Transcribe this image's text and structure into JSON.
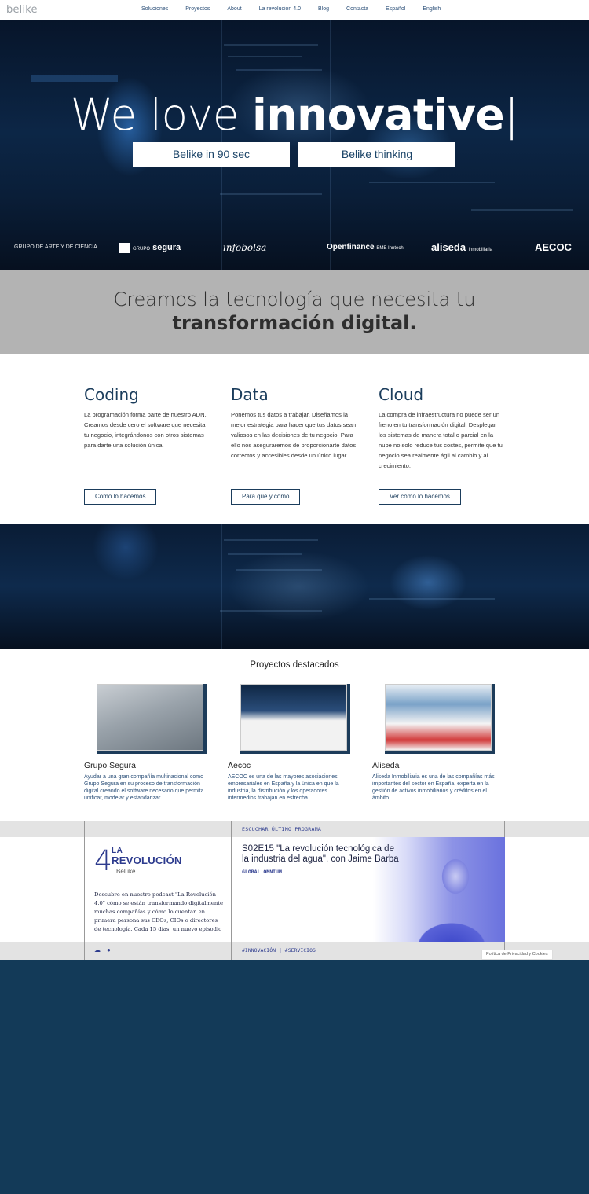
{
  "nav": {
    "logo": "belike",
    "items": [
      "Soluciones",
      "Proyectos",
      "About",
      "La revolución 4.0",
      "Blog",
      "Contacta",
      "Español",
      "English"
    ]
  },
  "hero": {
    "title_light": "We love ",
    "title_bold": "innovative",
    "cursor": "|",
    "btn1": "Belike in 90 sec",
    "btn2": "Belike thinking",
    "clients": [
      "GRUPO DE ARTE Y DE CIENCIA",
      "segura",
      "infobolsa",
      "Openfinance",
      "aliseda",
      "AECOC"
    ],
    "client_grupo_label": "GRUPO",
    "client_openfinance_sub": "BME Inntech",
    "client_aliseda_sub": "inmobiliaria"
  },
  "tagline": {
    "line1": "Creamos la tecnología que necesita tu",
    "line2": "transformación digital."
  },
  "services": [
    {
      "title": "Coding",
      "text": "La programación forma parte de nuestro ADN. Creamos desde cero el software que necesita tu negocio, integrándonos con otros sistemas para darte una solución única.",
      "button": "Cómo lo hacemos"
    },
    {
      "title": "Data",
      "text": "Ponemos tus datos a trabajar. Diseñamos la mejor estrategia para hacer que tus datos sean valiosos en las decisiones de tu negocio. Para ello nos aseguraremos de proporcionarte datos correctos y accesibles desde un único lugar.",
      "button": "Para qué y cómo"
    },
    {
      "title": "Cloud",
      "text": "La compra de infraestructura no puede ser un freno en tu transformación digital. Desplegar los sistemas de manera total o parcial en la nube no solo reduce tus costes, permite que tu negocio sea realmente ágil al cambio y al crecimiento.",
      "button": "Ver cómo lo hacemos"
    }
  ],
  "projects": {
    "title": "Proyectos destacados",
    "items": [
      {
        "name": "Grupo Segura",
        "text": "Ayudar a una gran compañía multinacional como Grupo Segura en su proceso de transformación digital creando el software necesario que permita unificar, modelar y estandarizar..."
      },
      {
        "name": "Aecoc",
        "text": "AECOC es una de las mayores asociaciones empresariales en España y la única en que la industria, la distribución y los operadores intermedios trabajan en estrecha..."
      },
      {
        "name": "Aliseda",
        "text": "Aliseda Inmobiliaria es una de las compañías más importantes del sector en España, experta en la gestión de activos inmobiliarios y créditos en el ámbito..."
      }
    ]
  },
  "podcast": {
    "listen_label": "ESCUCHAR ÚLTIMO PROGRAMA",
    "logo_four": "4",
    "logo_la": "LA",
    "logo_revolucion": "REVOLUCIÓN",
    "logo_by": "BeLike",
    "description": "Descubre en nuestro podcast \"La Revolución 4.0\" cómo se están transformando digitalmente muchas compañías y cómo lo cuentan en primera persona sus CEOs, CIOs o directores de tecnología. Cada 15 días, un nuevo episodio",
    "episode_title": "S02E15 \"La revolución tecnológica de la industria del agua\", con Jaime Barba",
    "guest_org": "GLOBAL OMNIUM",
    "tags": "#INNOVACIÓN | #SERVICIOS"
  },
  "cookie": "Política de Privacidad y Cookies"
}
